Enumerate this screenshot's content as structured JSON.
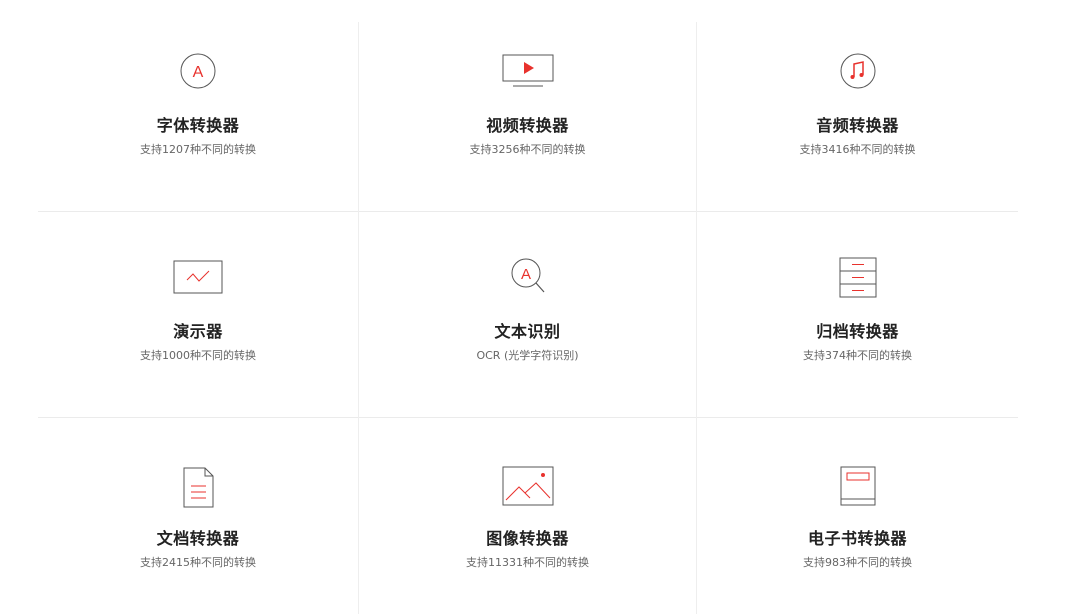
{
  "colors": {
    "accent": "#e8322d",
    "icon_stroke": "#555555",
    "divider": "#ebebeb"
  },
  "converters": [
    {
      "title": "字体转换器",
      "subtitle": "支持1207种不同的转换",
      "icon": "font-a-circle-icon"
    },
    {
      "title": "视频转换器",
      "subtitle": "支持3256种不同的转换",
      "icon": "video-play-icon"
    },
    {
      "title": "音频转换器",
      "subtitle": "支持3416种不同的转换",
      "icon": "music-note-icon"
    },
    {
      "title": "演示器",
      "subtitle": "支持1000种不同的转换",
      "icon": "presentation-icon"
    },
    {
      "title": "文本识别",
      "subtitle": "OCR (光学字符识别)",
      "icon": "ocr-magnifier-icon"
    },
    {
      "title": "归档转换器",
      "subtitle": "支持374种不同的转换",
      "icon": "archive-icon"
    },
    {
      "title": "文档转换器",
      "subtitle": "支持2415种不同的转换",
      "icon": "document-icon"
    },
    {
      "title": "图像转换器",
      "subtitle": "支持11331种不同的转换",
      "icon": "image-icon"
    },
    {
      "title": "电子书转换器",
      "subtitle": "支持983种不同的转换",
      "icon": "ebook-icon"
    }
  ],
  "glyphs": {
    "font_letter": "A",
    "ocr_letter": "A"
  }
}
